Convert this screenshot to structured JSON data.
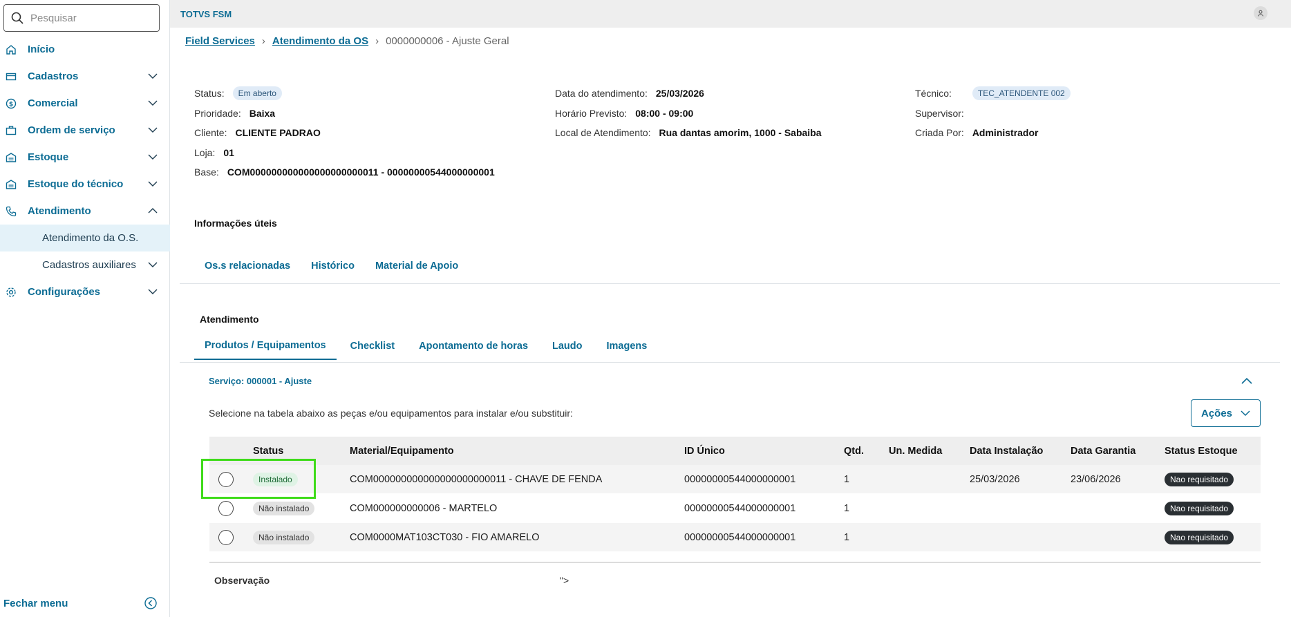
{
  "sidebar": {
    "search_placeholder": "Pesquisar",
    "items": [
      {
        "label": "Início",
        "icon": "home-icon",
        "chevron": ""
      },
      {
        "label": "Cadastros",
        "icon": "card-icon",
        "chevron": "down"
      },
      {
        "label": "Comercial",
        "icon": "dollar-icon",
        "chevron": "down"
      },
      {
        "label": "Ordem de serviço",
        "icon": "briefcase-icon",
        "chevron": "down"
      },
      {
        "label": "Estoque",
        "icon": "warehouse-icon",
        "chevron": "down"
      },
      {
        "label": "Estoque do técnico",
        "icon": "warehouse-icon",
        "chevron": "down"
      },
      {
        "label": "Atendimento",
        "icon": "phone-icon",
        "chevron": "up"
      }
    ],
    "subitems": [
      {
        "label": "Atendimento da O.S.",
        "active": true
      },
      {
        "label": "Cadastros auxiliares",
        "active": false
      }
    ],
    "config_label": "Configurações",
    "close_menu_label": "Fechar menu"
  },
  "topbar": {
    "brand": "TOTVS FSM"
  },
  "breadcrumb": {
    "item1": "Field Services",
    "item2": "Atendimento da OS",
    "current": "0000000006 - Ajuste Geral"
  },
  "info": {
    "status_label": "Status:",
    "status_value": "Em aberto",
    "prioridade_label": "Prioridade:",
    "prioridade_value": "Baixa",
    "cliente_label": "Cliente:",
    "cliente_value": "CLIENTE PADRAO",
    "loja_label": "Loja:",
    "loja_value": "01",
    "base_label": "Base:",
    "base_value": "COM000000000000000000000011 - 00000000544000000001",
    "data_label": "Data do atendimento:",
    "data_value": "25/03/2026",
    "horario_label": "Horário Previsto:",
    "horario_value": "08:00 - 09:00",
    "local_label": "Local de Atendimento:",
    "local_value": "Rua dantas amorim, 1000 - Sabaiba",
    "tecnico_label": "Técnico:",
    "tecnico_value": "TEC_ATENDENTE 002",
    "supervisor_label": "Supervisor:",
    "supervisor_value": "",
    "criada_label": "Criada Por:",
    "criada_value": "Administrador"
  },
  "useful_info": {
    "title": "Informações úteis",
    "tabs": [
      "Os.s relacionadas",
      "Histórico",
      "Material de Apoio"
    ]
  },
  "atendimento": {
    "title": "Atendimento",
    "tabs": [
      "Produtos / Equipamentos",
      "Checklist",
      "Apontamento de horas",
      "Laudo",
      "Imagens"
    ]
  },
  "service": {
    "label": "Serviço: 000001 - Ajuste",
    "helper": "Selecione na tabela abaixo as peças e/ou equipamentos para instalar e/ou substituir:",
    "acoes_label": "Ações"
  },
  "table": {
    "headers": [
      "Status",
      "Material/Equipamento",
      "ID Único",
      "Qtd.",
      "Un. Medida",
      "Data Instalação",
      "Data Garantia",
      "Status Estoque"
    ],
    "rows": [
      {
        "status": "Instalado",
        "status_type": "ok",
        "material": "COM000000000000000000000011 - CHAVE DE FENDA",
        "id": "00000000544000000001",
        "qtd": "1",
        "un": "",
        "data_inst": "25/03/2026",
        "data_gar": "23/06/2026",
        "estoque": "Nao requisitado"
      },
      {
        "status": "Não instalado",
        "status_type": "no",
        "material": "COM000000000006 - MARTELO",
        "id": "00000000544000000001",
        "qtd": "1",
        "un": "",
        "data_inst": "",
        "data_gar": "",
        "estoque": "Nao requisitado"
      },
      {
        "status": "Não instalado",
        "status_type": "no",
        "material": "COM0000MAT103CT030 - FIO AMARELO",
        "id": "00000000544000000001",
        "qtd": "1",
        "un": "",
        "data_inst": "",
        "data_gar": "",
        "estoque": "Nao requisitado"
      }
    ]
  },
  "observacao": {
    "label": "Observação",
    "value": "\">"
  },
  "colors": {
    "accent": "#0c6c94",
    "highlight": "#3fdb1a"
  }
}
